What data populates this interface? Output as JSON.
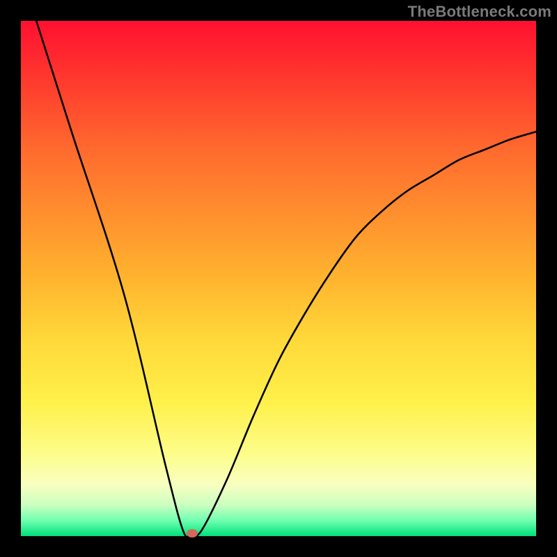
{
  "watermark": "TheBottleneck.com",
  "chart_data": {
    "type": "line",
    "title": "",
    "xlabel": "",
    "ylabel": "",
    "xlim": [
      0,
      100
    ],
    "ylim": [
      0,
      100
    ],
    "series": [
      {
        "name": "curve",
        "x": [
          3,
          10,
          20,
          28,
          31.5,
          33,
          35,
          40,
          45,
          50,
          55,
          60,
          65,
          70,
          75,
          80,
          85,
          90,
          95,
          100
        ],
        "y": [
          100,
          78,
          47,
          14,
          1,
          0.5,
          1,
          11,
          23,
          34,
          43,
          51,
          58,
          63,
          67,
          70,
          73,
          75,
          77,
          78.5
        ]
      }
    ],
    "marker": {
      "x": 33.3,
      "y": 0.5
    },
    "background": "red-to-green vertical gradient"
  }
}
